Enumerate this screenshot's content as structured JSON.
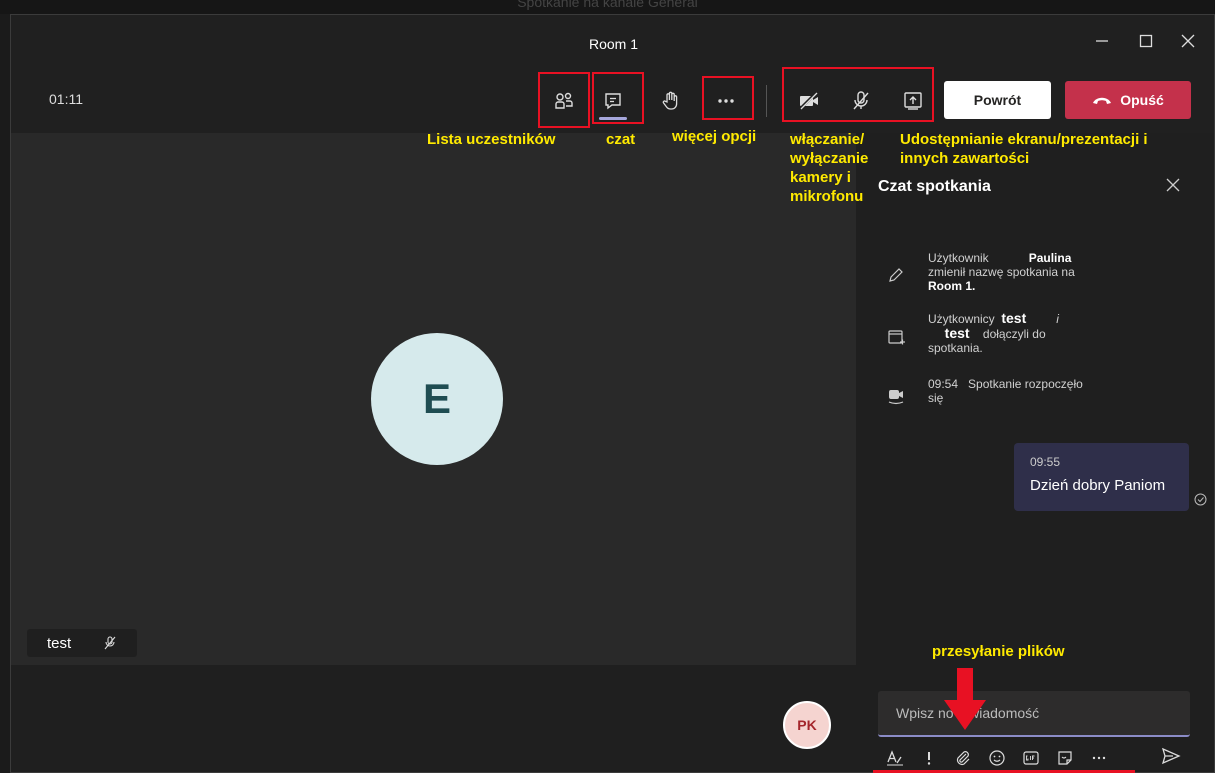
{
  "background_window_title": "Spotkanie na kanale General",
  "window": {
    "title": "Room 1"
  },
  "toolbar": {
    "timer": "01:11",
    "back_label": "Powrót",
    "leave_label": "Opuść"
  },
  "participant": {
    "initial": "E",
    "name": "test"
  },
  "me": {
    "initials": "PK"
  },
  "chat": {
    "title": "Czat spotkania",
    "event1": {
      "prefix": "Użytkownik",
      "user": "Paulina",
      "text": "zmienił nazwę spotkania na",
      "room": "Room 1."
    },
    "event2": {
      "prefix": "Użytkownicy",
      "user1": "test",
      "conj": "i",
      "user2": "test",
      "text1": "dołączyli do",
      "text2": "spotkania."
    },
    "event3": {
      "time": "09:54",
      "text1": "Spotkanie rozpoczęło",
      "text2": "się"
    },
    "message": {
      "time": "09:55",
      "text": "Dzień dobry Paniom"
    },
    "compose_placeholder_left": "Wpisz no",
    "compose_placeholder_right": "wiadomość"
  },
  "annotations": {
    "participants": "Lista uczestników",
    "chat": "czat",
    "more": "więcej opcji",
    "media_line1": "włączanie/",
    "media_line2": "wyłączanie",
    "media_line3": "kamery i",
    "media_line4": "mikrofonu",
    "share_line1": "Udostępnianie ekranu/prezentacji i",
    "share_line2": "innych zawartości",
    "files": "przesyłanie plików"
  },
  "colors": {
    "accent": "#a6a7dc",
    "leave": "#c4314b",
    "annotation": "#ffea00",
    "highlight": "#e81123"
  }
}
